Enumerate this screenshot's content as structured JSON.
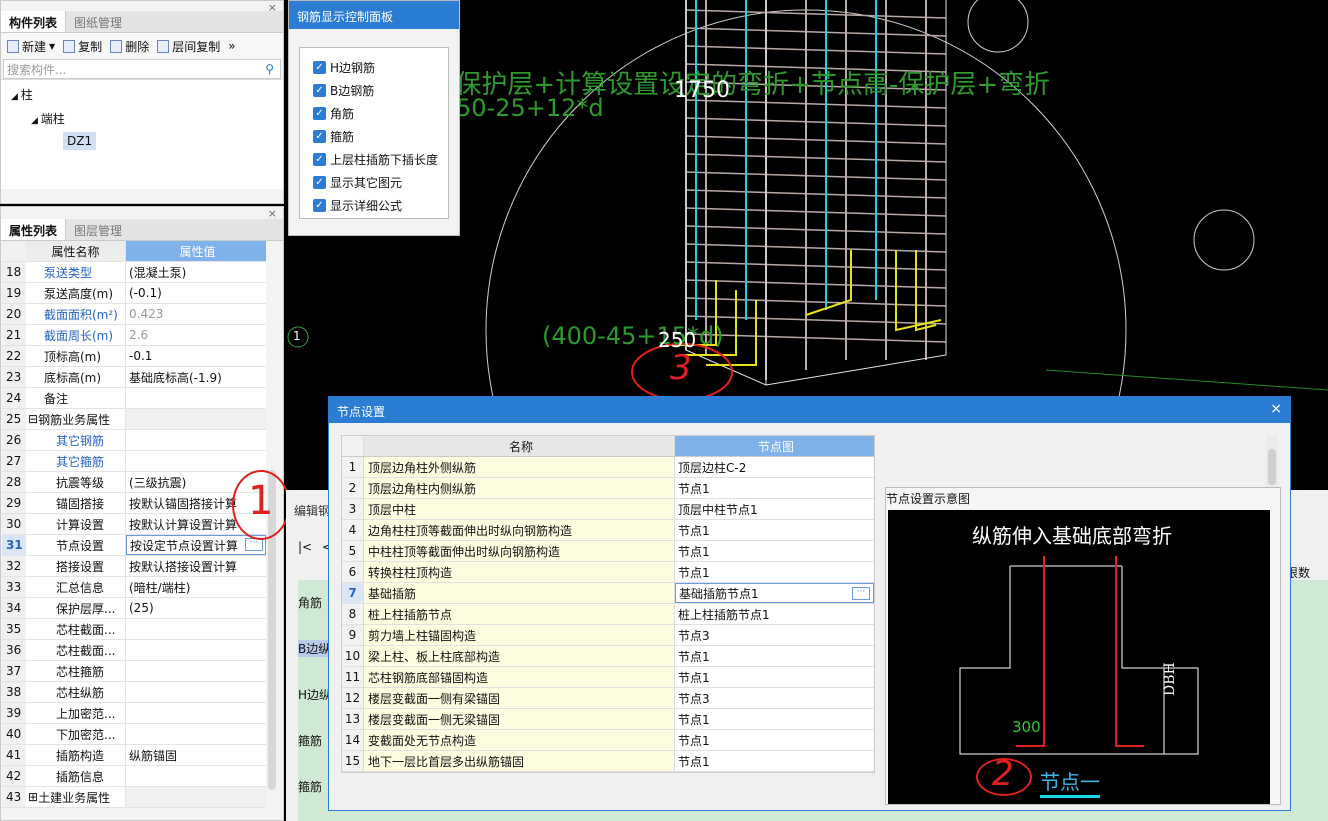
{
  "viewport": {
    "formula_line1": "-保护层+计算设置设定的弯折+节点高-保护层+弯折",
    "formula_line2": "50-25+12*d",
    "formula_label": "(400-45+15*d)",
    "dim_1750": "1750",
    "dim_250": "250",
    "axis_marker": "1",
    "annotation_3": "3",
    "annotation_1": "1"
  },
  "component_panel": {
    "tabs": [
      "构件列表",
      "图纸管理"
    ],
    "toolbar": {
      "new": "新建",
      "copy": "复制",
      "delete": "删除",
      "floor_copy": "层间复制",
      "more": "»"
    },
    "search_placeholder": "搜索构件...",
    "tree": {
      "root": "柱",
      "child": "端柱",
      "leaf": "DZ1"
    }
  },
  "property_panel": {
    "tabs": [
      "属性列表",
      "图层管理"
    ],
    "header": {
      "name": "属性名称",
      "value": "属性值"
    },
    "rows": [
      {
        "n": "18",
        "name": "泵送类型",
        "value": "(混凝土泵)",
        "style": "blue"
      },
      {
        "n": "19",
        "name": "泵送高度(m)",
        "value": "(-0.1)",
        "style": ""
      },
      {
        "n": "20",
        "name": "截面面积(m²)",
        "value": "0.423",
        "style": "blue-gray"
      },
      {
        "n": "21",
        "name": "截面周长(m)",
        "value": "2.6",
        "style": "blue-gray"
      },
      {
        "n": "22",
        "name": "顶标高(m)",
        "value": "-0.1",
        "style": ""
      },
      {
        "n": "23",
        "name": "底标高(m)",
        "value": "基础底标高(-1.9)",
        "style": ""
      },
      {
        "n": "24",
        "name": "备注",
        "value": "",
        "style": ""
      },
      {
        "n": "25",
        "name": "钢筋业务属性",
        "value": "",
        "style": "group"
      },
      {
        "n": "26",
        "name": "其它钢筋",
        "value": "",
        "style": "sub-blue"
      },
      {
        "n": "27",
        "name": "其它箍筋",
        "value": "",
        "style": "sub-blue"
      },
      {
        "n": "28",
        "name": "抗震等级",
        "value": "(三级抗震)",
        "style": "sub"
      },
      {
        "n": "29",
        "name": "锚固搭接",
        "value": "按默认锚固搭接计算",
        "style": "sub"
      },
      {
        "n": "30",
        "name": "计算设置",
        "value": "按默认计算设置计算",
        "style": "sub"
      },
      {
        "n": "31",
        "name": "节点设置",
        "value": "按设定节点设置计算",
        "style": "sub-sel"
      },
      {
        "n": "32",
        "name": "搭接设置",
        "value": "按默认搭接设置计算",
        "style": "sub"
      },
      {
        "n": "33",
        "name": "汇总信息",
        "value": "(暗柱/端柱)",
        "style": "sub"
      },
      {
        "n": "34",
        "name": "保护层厚...",
        "value": "(25)",
        "style": "sub"
      },
      {
        "n": "35",
        "name": "芯柱截面...",
        "value": "",
        "style": "sub"
      },
      {
        "n": "36",
        "name": "芯柱截面...",
        "value": "",
        "style": "sub"
      },
      {
        "n": "37",
        "name": "芯柱箍筋",
        "value": "",
        "style": "sub"
      },
      {
        "n": "38",
        "name": "芯柱纵筋",
        "value": "",
        "style": "sub"
      },
      {
        "n": "39",
        "name": "上加密范...",
        "value": "",
        "style": "sub"
      },
      {
        "n": "40",
        "name": "下加密范...",
        "value": "",
        "style": "sub"
      },
      {
        "n": "41",
        "name": "插筋构造",
        "value": "纵筋锚固",
        "style": "sub"
      },
      {
        "n": "42",
        "name": "插筋信息",
        "value": "",
        "style": "sub"
      },
      {
        "n": "43",
        "name": "土建业务属性",
        "value": "",
        "style": "group"
      }
    ]
  },
  "rebar_panel": {
    "title": "钢筋显示控制面板",
    "options": [
      "H边钢筋",
      "B边钢筋",
      "角筋",
      "箍筋",
      "上层柱插筋下插长度",
      "显示其它图元",
      "显示详细公式"
    ]
  },
  "node_dialog": {
    "title": "节点设置",
    "close": "×",
    "header": {
      "name": "名称",
      "value": "节点图"
    },
    "rows": [
      {
        "n": "1",
        "name": "顶层边角柱外侧纵筋",
        "value": "顶层边柱C-2"
      },
      {
        "n": "2",
        "name": "顶层边角柱内侧纵筋",
        "value": "节点1"
      },
      {
        "n": "3",
        "name": "顶层中柱",
        "value": "顶层中柱节点1"
      },
      {
        "n": "4",
        "name": "边角柱柱顶等截面伸出时纵向钢筋构造",
        "value": "节点1"
      },
      {
        "n": "5",
        "name": "中柱柱顶等截面伸出时纵向钢筋构造",
        "value": "节点1"
      },
      {
        "n": "6",
        "name": "转换柱柱顶构造",
        "value": "节点1"
      },
      {
        "n": "7",
        "name": "基础插筋",
        "value": "基础插筋节点1",
        "selected": true
      },
      {
        "n": "8",
        "name": "桩上柱插筋节点",
        "value": "桩上柱插筋节点1"
      },
      {
        "n": "9",
        "name": "剪力墙上柱锚固构造",
        "value": "节点3"
      },
      {
        "n": "10",
        "name": "梁上柱、板上柱底部构造",
        "value": "节点1"
      },
      {
        "n": "11",
        "name": "芯柱钢筋底部锚固构造",
        "value": "节点1"
      },
      {
        "n": "12",
        "name": "楼层变截面一侧有梁锚固",
        "value": "节点3"
      },
      {
        "n": "13",
        "name": "楼层变截面一侧无梁锚固",
        "value": "节点1"
      },
      {
        "n": "14",
        "name": "变截面处无节点构造",
        "value": "节点1"
      },
      {
        "n": "15",
        "name": "地下一层比首层多出纵筋锚固",
        "value": "节点1"
      }
    ],
    "preview_title": "节点设置示意图",
    "diagram": {
      "title": "纵筋伸入基础底部弯折",
      "dim_300": "300",
      "dim_dbh": "DBH",
      "caption": "节点一",
      "annotation_2": "2"
    }
  },
  "editor_strip": {
    "label_partial": "编辑钢",
    "nav_first": "|<",
    "nav_prev": "<",
    "right_header": "根数",
    "rows": [
      "角筋",
      "B边纵",
      "H边纵",
      "箍筋",
      "箍筋"
    ]
  },
  "colors": {
    "accent": "#2b7cd3",
    "green_text": "#2e9a2e",
    "rebar": "#b9aaa5",
    "cyan": "#19d3e6",
    "yellow": "#e6e219",
    "annotation_red": "#e0201c"
  }
}
